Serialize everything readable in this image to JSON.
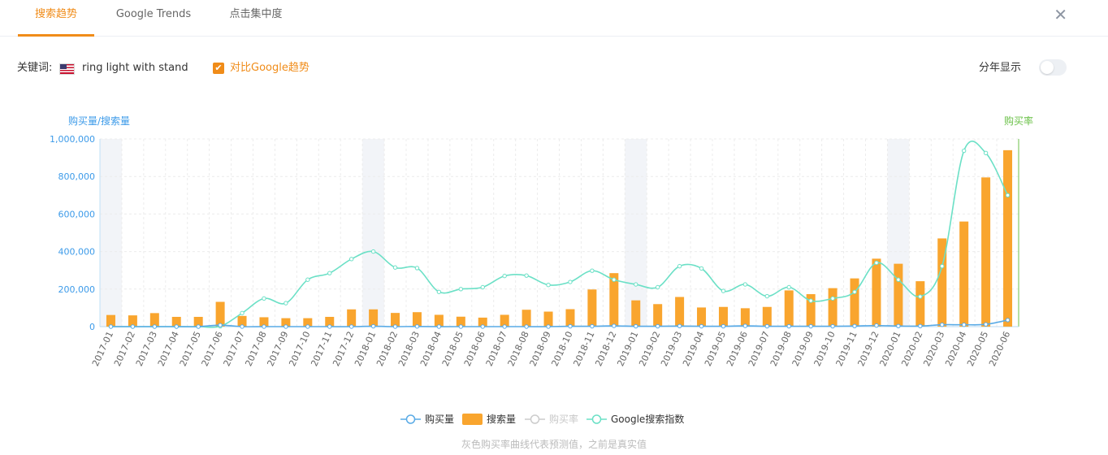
{
  "tabs": [
    {
      "label": "搜索趋势",
      "active": true
    },
    {
      "label": "Google Trends",
      "active": false
    },
    {
      "label": "点击集中度",
      "active": false
    }
  ],
  "close_icon": "close-icon",
  "keyword": {
    "label": "关键词:",
    "flag_icon": "us-flag-icon",
    "value": "ring light with stand"
  },
  "compare": {
    "label": "对比Google趋势",
    "checked": true
  },
  "year_split": {
    "label": "分年显示",
    "on": false
  },
  "colors": {
    "accent": "#f08c19",
    "bars": "#f9a52e",
    "purchase_line": "#5aabe6",
    "google_line": "#6be0c6",
    "right_axis": "#6cc24a",
    "left_axis": "#3d9be9"
  },
  "chart_data": {
    "type": "bar",
    "left_axis_label": "购买量/搜索量",
    "right_axis_label": "购买率",
    "y_ticks": [
      "0",
      "200,000",
      "400,000",
      "600,000",
      "800,000",
      "1,000,000"
    ],
    "ylim": [
      0,
      1000000
    ],
    "x": [
      "2017-01",
      "2017-02",
      "2017-03",
      "2017-04",
      "2017-05",
      "2017-06",
      "2017-07",
      "2017-08",
      "2017-09",
      "2017-10",
      "2017-11",
      "2017-12",
      "2018-01",
      "2018-02",
      "2018-03",
      "2018-04",
      "2018-05",
      "2018-06",
      "2018-07",
      "2018-08",
      "2018-09",
      "2018-10",
      "2018-11",
      "2018-12",
      "2019-01",
      "2019-02",
      "2019-03",
      "2019-04",
      "2019-05",
      "2019-06",
      "2019-07",
      "2019-08",
      "2019-09",
      "2019-10",
      "2019-11",
      "2019-12",
      "2020-01",
      "2020-02",
      "2020-03",
      "2020-04",
      "2020-05",
      "2020-06"
    ],
    "highlight_months": [
      "2017-01",
      "2018-01",
      "2019-01",
      "2020-01"
    ],
    "series": [
      {
        "name": "购买量",
        "type": "line",
        "values": [
          0,
          0,
          0,
          0,
          0,
          8000,
          0,
          0,
          0,
          0,
          0,
          0,
          2000,
          0,
          1000,
          0,
          0,
          0,
          0,
          0,
          0,
          2000,
          2000,
          4000,
          2000,
          2000,
          3000,
          2000,
          2000,
          4000,
          2000,
          2000,
          2000,
          2000,
          3000,
          6000,
          3000,
          3000,
          10000,
          10000,
          12000,
          35000
        ]
      },
      {
        "name": "搜索量",
        "type": "bar",
        "values": [
          62000,
          60000,
          72000,
          52000,
          52000,
          132000,
          57000,
          50000,
          45000,
          45000,
          52000,
          92000,
          92000,
          73000,
          77000,
          63000,
          53000,
          48000,
          63000,
          90000,
          80000,
          93000,
          198000,
          285000,
          140000,
          120000,
          158000,
          102000,
          105000,
          98000,
          105000,
          193000,
          173000,
          205000,
          257000,
          362000,
          335000,
          242000,
          470000,
          560000,
          795000,
          940000
        ]
      },
      {
        "name": "购买率",
        "type": "line",
        "visible": false,
        "values": []
      },
      {
        "name": "Google搜索指数",
        "type": "line",
        "axis": "right",
        "values": [
          0,
          0,
          0,
          0,
          0,
          2000,
          72000,
          150000,
          125000,
          250000,
          285000,
          360000,
          400000,
          315000,
          312000,
          185000,
          200000,
          210000,
          270000,
          272000,
          222000,
          238000,
          298000,
          250000,
          225000,
          210000,
          322000,
          310000,
          190000,
          225000,
          162000,
          210000,
          138000,
          150000,
          185000,
          340000,
          250000,
          160000,
          322000,
          937000,
          925000,
          700000
        ]
      }
    ]
  },
  "legend": [
    {
      "label": "购买量",
      "icon": "line-circle-icon",
      "active": true
    },
    {
      "label": "搜索量",
      "icon": "bar-rect-icon",
      "active": true
    },
    {
      "label": "购买率",
      "icon": "line-circle-icon",
      "active": false
    },
    {
      "label": "Google搜索指数",
      "icon": "line-circle-icon",
      "active": true
    }
  ],
  "footnote": "灰色购买率曲线代表预测值，之前是真实值"
}
